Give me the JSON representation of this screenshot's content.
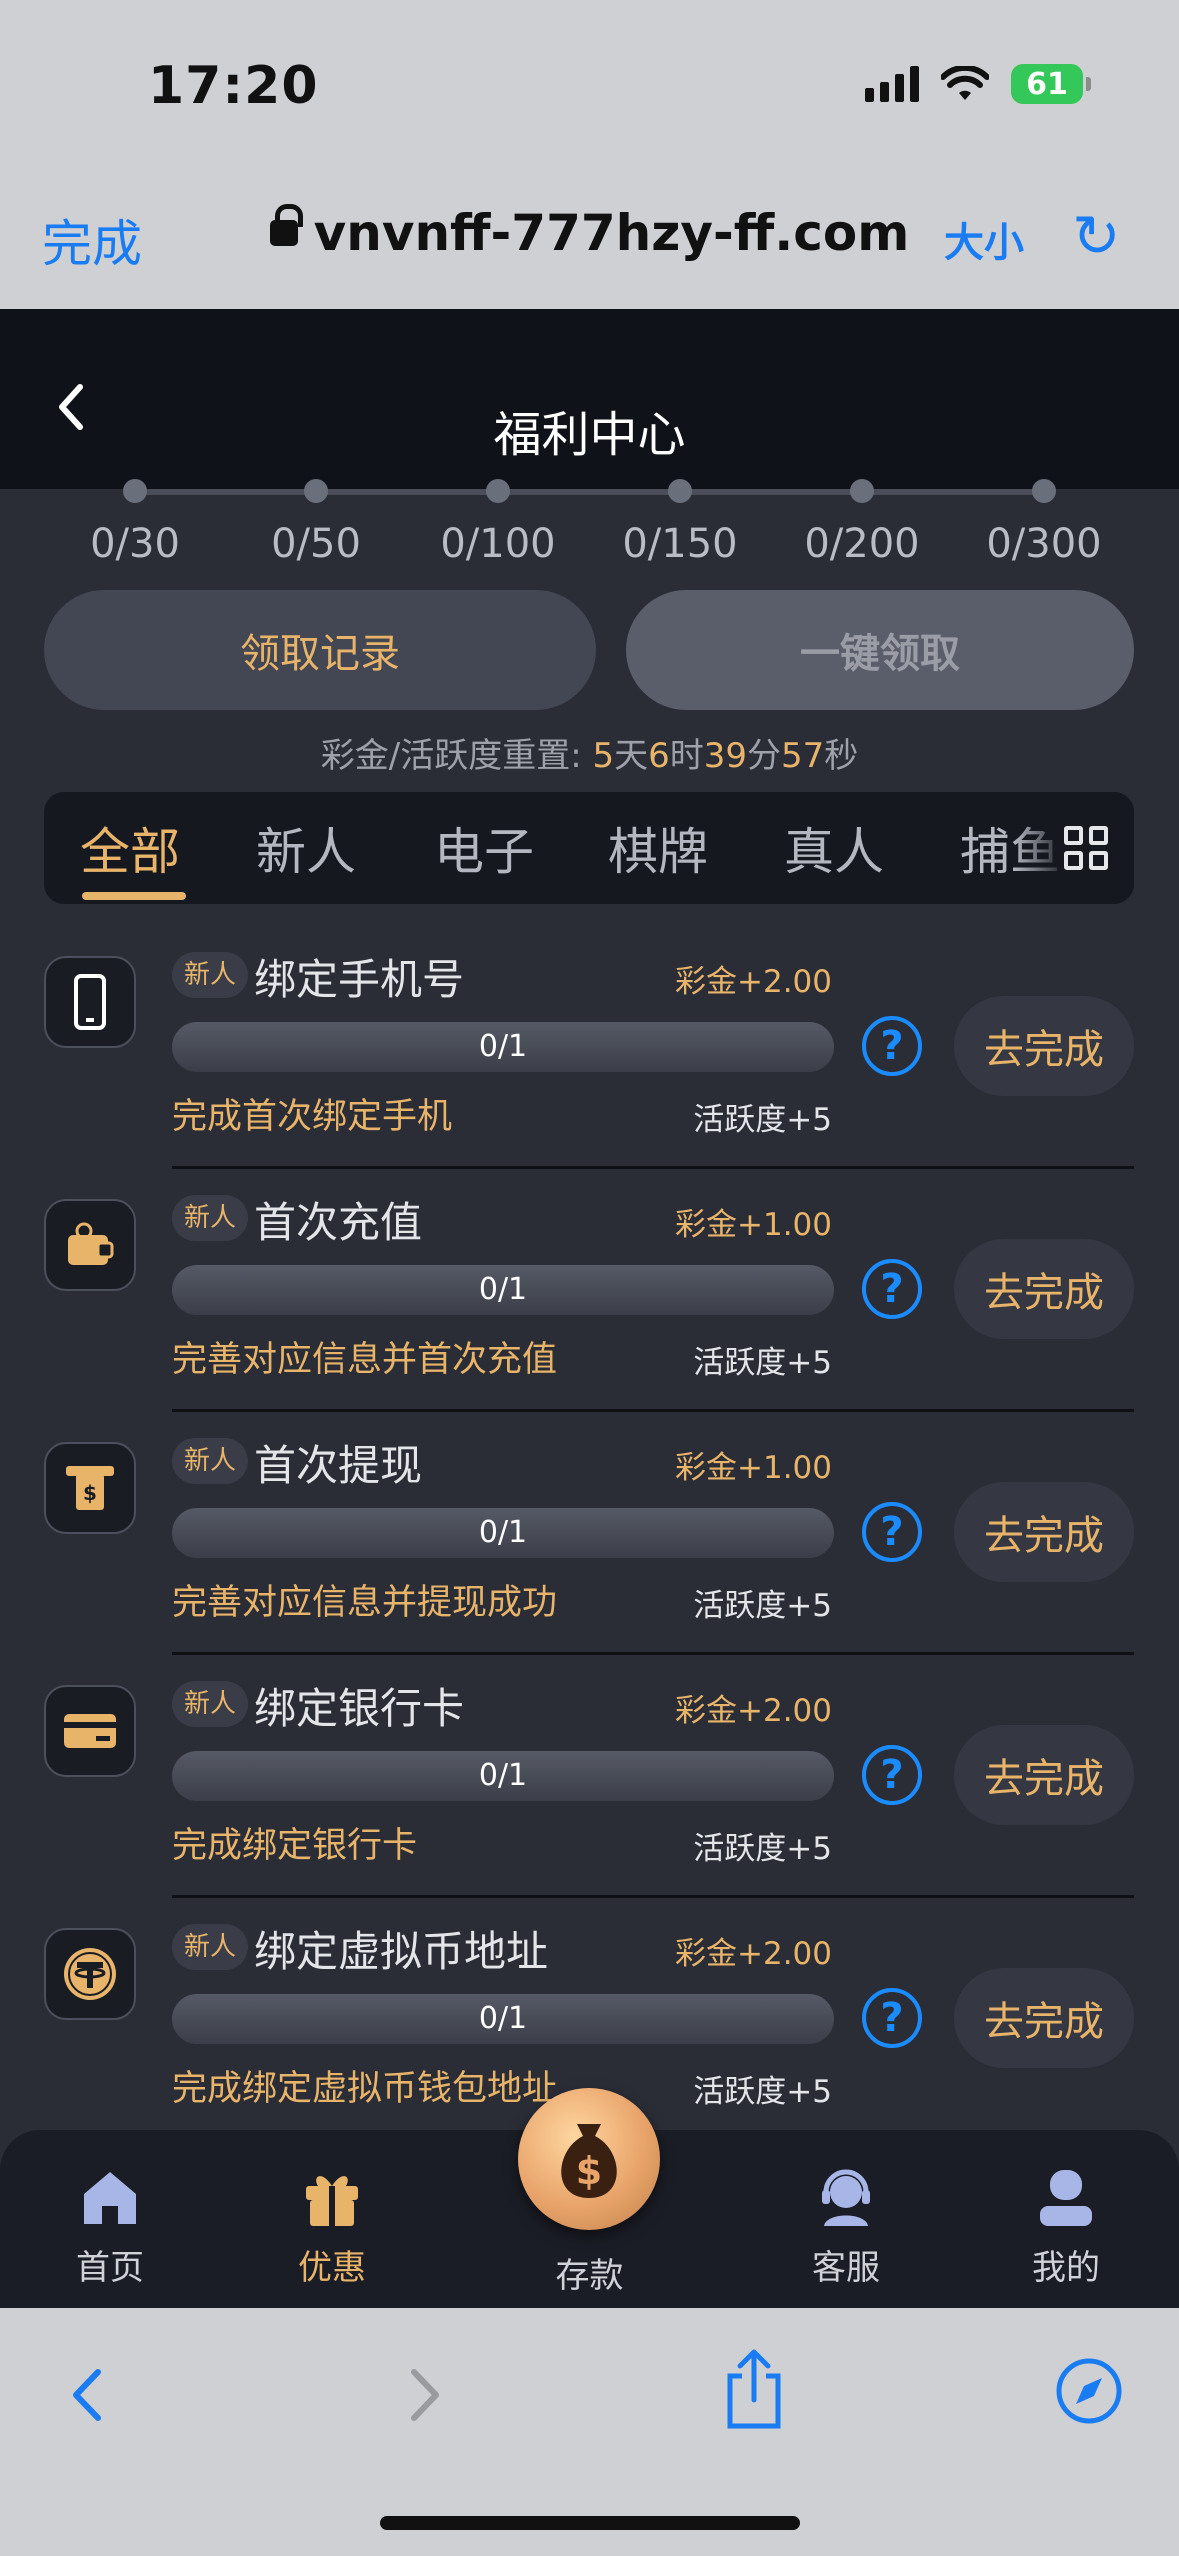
{
  "status_bar": {
    "time": "17:20",
    "battery": "61"
  },
  "browser": {
    "done_label": "完成",
    "url": "vnvnff-777hzy-ff.com",
    "text_size_label": "大小"
  },
  "header": {
    "title": "福利中心"
  },
  "milestones": [
    "0/30",
    "0/50",
    "0/100",
    "0/150",
    "0/200",
    "0/300"
  ],
  "actions": {
    "records_label": "领取记录",
    "claim_all_label": "一键领取"
  },
  "reset": {
    "prefix": "彩金/活跃度重置: ",
    "days": "5",
    "days_unit": "天",
    "hours": "6",
    "hours_unit": "时",
    "minutes": "39",
    "minutes_unit": "分",
    "seconds": "57",
    "seconds_unit": "秒"
  },
  "tabs": [
    "全部",
    "新人",
    "电子",
    "棋牌",
    "真人",
    "捕鱼"
  ],
  "tasks": [
    {
      "badge": "新人",
      "name": "绑定手机号",
      "reward": "彩金+2.00",
      "progress": "0/1",
      "desc": "完成首次绑定手机",
      "active": "活跃度+5",
      "button": "去完成",
      "icon": "phone-icon"
    },
    {
      "badge": "新人",
      "name": "首次充值",
      "reward": "彩金+1.00",
      "progress": "0/1",
      "desc": "完善对应信息并首次充值",
      "active": "活跃度+5",
      "button": "去完成",
      "icon": "wallet-icon"
    },
    {
      "badge": "新人",
      "name": "首次提现",
      "reward": "彩金+1.00",
      "progress": "0/1",
      "desc": "完善对应信息并提现成功",
      "active": "活跃度+5",
      "button": "去完成",
      "icon": "atm-icon"
    },
    {
      "badge": "新人",
      "name": "绑定银行卡",
      "reward": "彩金+2.00",
      "progress": "0/1",
      "desc": "完成绑定银行卡",
      "active": "活跃度+5",
      "button": "去完成",
      "icon": "bank-card-icon"
    },
    {
      "badge": "新人",
      "name": "绑定虚拟币地址",
      "reward": "彩金+2.00",
      "progress": "0/1",
      "desc": "完成绑定虚拟币钱包地址",
      "active": "活跃度+5",
      "button": "去完成",
      "icon": "tether-icon"
    }
  ],
  "nav": {
    "home": "首页",
    "promo": "优惠",
    "deposit": "存款",
    "support": "客服",
    "mine": "我的"
  },
  "colors": {
    "accent": "#e8b46a",
    "link_blue": "#1a7cf2",
    "background": "#2a2d36"
  }
}
